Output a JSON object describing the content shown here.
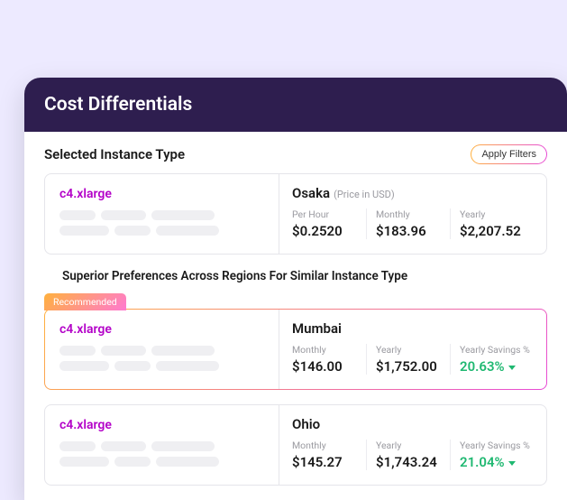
{
  "header": {
    "title": "Cost Differentials"
  },
  "section_title": "Selected Instance Type",
  "apply_filters_label": "Apply Filters",
  "subheader": "Superior Preferences Across Regions For Similar Instance Type",
  "recommended_label": "Recommended",
  "selected": {
    "instance": "c4.xlarge",
    "region": "Osaka",
    "price_note": "(Price in USD)",
    "metrics": {
      "per_hour_label": "Per Hour",
      "per_hour": "$0.2520",
      "monthly_label": "Monthly",
      "monthly": "$183.96",
      "yearly_label": "Yearly",
      "yearly": "$2,207.52"
    }
  },
  "alternatives": [
    {
      "instance": "c4.xlarge",
      "region": "Mumbai",
      "monthly_label": "Monthly",
      "monthly": "$146.00",
      "yearly_label": "Yearly",
      "yearly": "$1,752.00",
      "savings_label": "Yearly Savings %",
      "savings": "20.63%"
    },
    {
      "instance": "c4.xlarge",
      "region": "Ohio",
      "monthly_label": "Monthly",
      "monthly": "$145.27",
      "yearly_label": "Yearly",
      "yearly": "$1,743.24",
      "savings_label": "Yearly Savings %",
      "savings": "21.04%"
    }
  ]
}
